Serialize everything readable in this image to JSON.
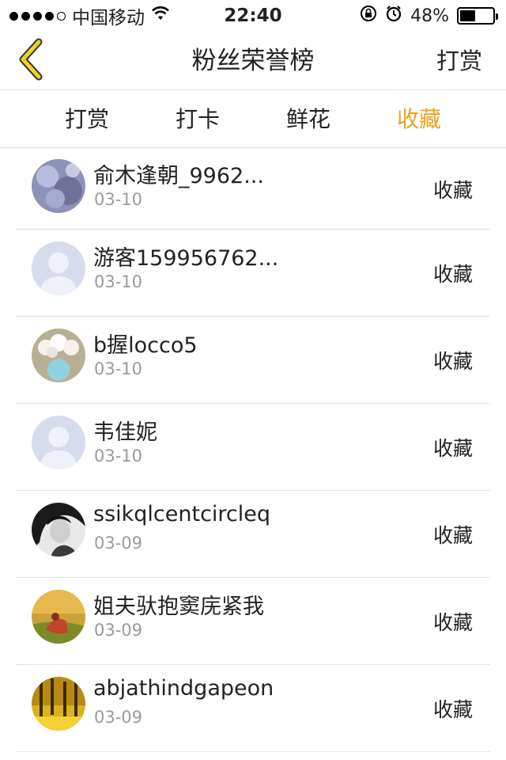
{
  "status_bar": {
    "carrier": "中国移动",
    "time": "22:40",
    "battery_percent": "48%",
    "battery_level": 0.48
  },
  "nav": {
    "title": "粉丝荣誉榜",
    "right_label": "打赏",
    "back_icon": "chevron-left-icon",
    "accent": "#f0a020"
  },
  "tabs": [
    {
      "label": "打赏",
      "active": false
    },
    {
      "label": "打卡",
      "active": false
    },
    {
      "label": "鲜花",
      "active": false
    },
    {
      "label": "收藏",
      "active": true
    }
  ],
  "entries": [
    {
      "name": "俞木逢朝_9962...",
      "date": "03-10",
      "action": "收藏",
      "avatar": "photo-lavender"
    },
    {
      "name": "游客159956762...",
      "date": "03-10",
      "action": "收藏",
      "avatar": "default-avatar"
    },
    {
      "name": "b握locco5",
      "date": "03-10",
      "action": "收藏",
      "avatar": "photo-flowers"
    },
    {
      "name": "韦佳妮",
      "date": "03-10",
      "action": "收藏",
      "avatar": "default-avatar"
    },
    {
      "name": "ssikqlcentcircleq",
      "date": "03-09",
      "action": "收藏",
      "avatar": "photo-portrait-bw"
    },
    {
      "name": "姐夫驮抱窦庑紧我",
      "date": "03-09",
      "action": "收藏",
      "avatar": "photo-autumn"
    },
    {
      "name": "abjathindgapeon",
      "date": "03-09",
      "action": "收藏",
      "avatar": "photo-yellow-trees"
    }
  ]
}
